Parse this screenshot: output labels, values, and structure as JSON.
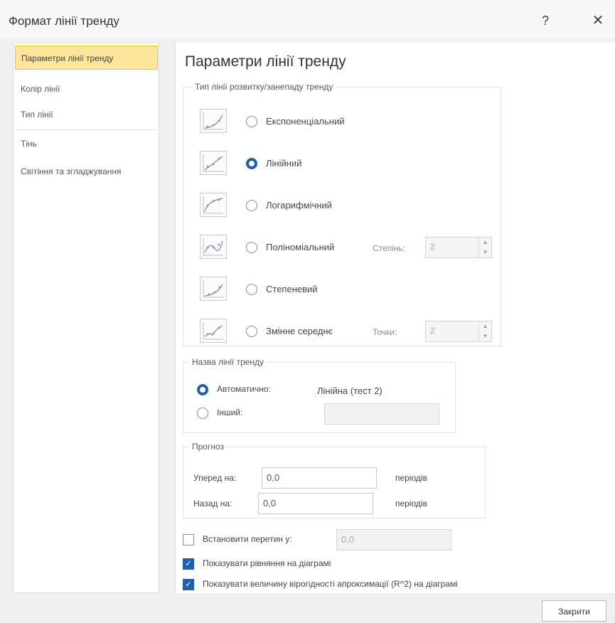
{
  "window": {
    "title": "Формат лінії тренду",
    "help": "?",
    "close": "✕"
  },
  "sidebar": {
    "items": [
      {
        "label": "Параметри лінії тренду"
      },
      {
        "label": "Колір лінії"
      },
      {
        "label": "Тип лінії"
      },
      {
        "label": "Тінь"
      },
      {
        "label": "Світіння та згладжування"
      }
    ]
  },
  "main": {
    "heading": "Параметри лінії тренду",
    "type_group": {
      "legend": "Тип лінії розвитку/занепаду тренду",
      "options": [
        {
          "label": "Експоненціальний",
          "selected": false
        },
        {
          "label": "Лінійний",
          "selected": true
        },
        {
          "label": "Логарифмічний",
          "selected": false
        },
        {
          "label": "Поліноміальний",
          "selected": false
        },
        {
          "label": "Степеневий",
          "selected": false
        },
        {
          "label": "Змінне середнє",
          "selected": false
        }
      ],
      "degree_label": "Степінь:",
      "degree_value": "2",
      "period_label": "Точки:",
      "period_value": "2"
    },
    "name_group": {
      "legend": "Назва лінії тренду",
      "auto_label": "Автоматично:",
      "auto_value": "Лінійна (тест 2)",
      "custom_label": "Інший:",
      "custom_value": "",
      "selected": "auto"
    },
    "forecast_group": {
      "legend": "Прогноз",
      "forward_label": "Уперед на:",
      "forward_value": "0,0",
      "backward_label": "Назад на:",
      "backward_value": "0,0",
      "unit": "періодів"
    },
    "intercept": {
      "label": "Встановити перетин у:",
      "value": "0,0",
      "checked": false
    },
    "show_equation": {
      "label": "Показувати рівняння на діаграмі",
      "checked": true
    },
    "show_r2": {
      "label": "Показувати величину вірогідності апроксимації (R^2) на діаграмі",
      "checked": true
    }
  },
  "footer": {
    "close_label": "Закрити"
  },
  "colors": {
    "accent": "#1f5fb0",
    "nav_active_bg": "#fde599",
    "nav_active_border": "#f2c811"
  }
}
